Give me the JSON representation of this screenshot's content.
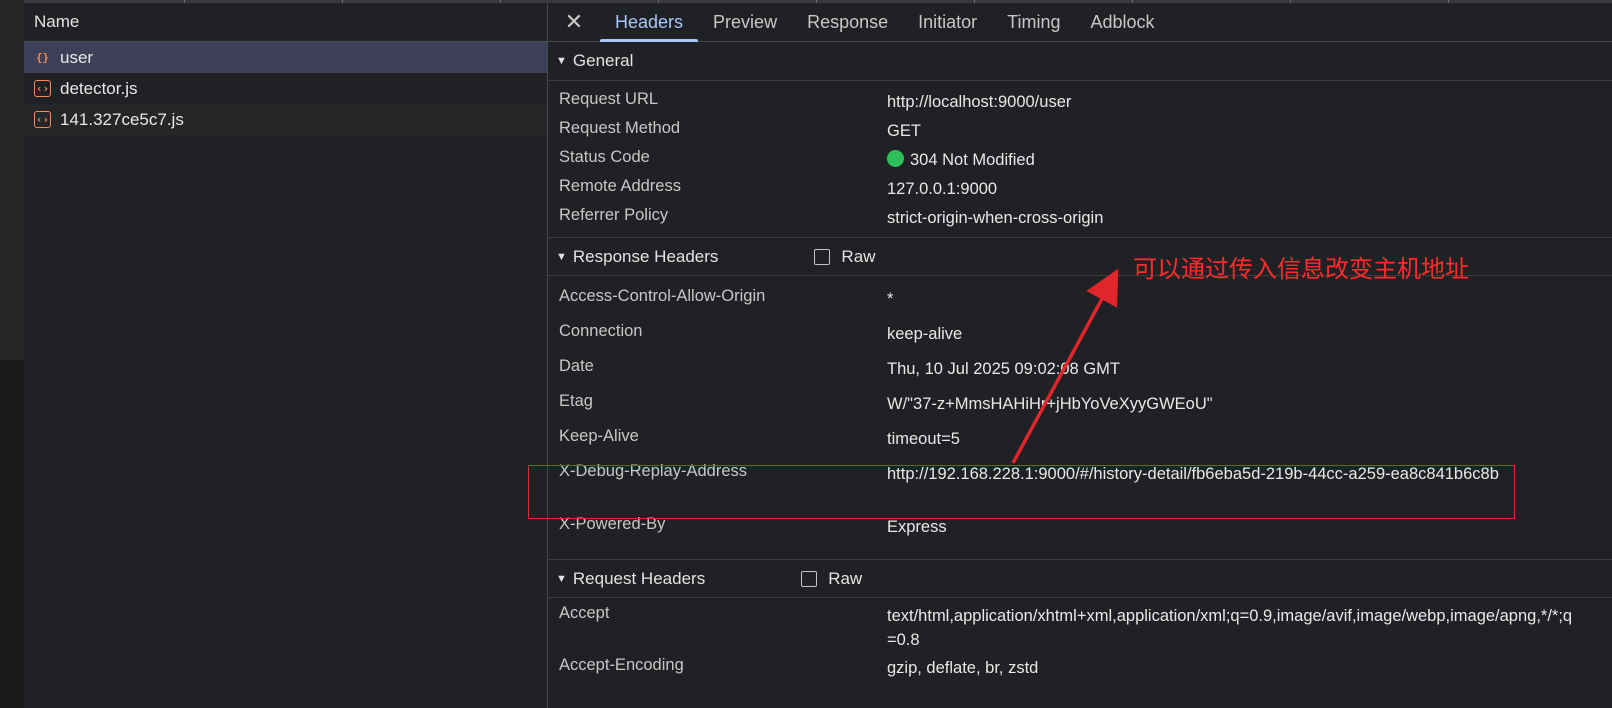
{
  "request_list": {
    "header": "Name",
    "items": [
      {
        "name": "user",
        "type": "json-icon"
      },
      {
        "name": "detector.js",
        "type": "js-icon"
      },
      {
        "name": "141.327ce5c7.js",
        "type": "js-icon"
      }
    ]
  },
  "tabs": [
    "Headers",
    "Preview",
    "Response",
    "Initiator",
    "Timing",
    "Adblock"
  ],
  "active_tab": "Headers",
  "general": {
    "title": "General",
    "rows": [
      {
        "key": "Request URL",
        "value": "http://localhost:9000/user"
      },
      {
        "key": "Request Method",
        "value": "GET"
      },
      {
        "key": "Status Code",
        "value": "304 Not Modified"
      },
      {
        "key": "Remote Address",
        "value": "127.0.0.1:9000"
      },
      {
        "key": "Referrer Policy",
        "value": "strict-origin-when-cross-origin"
      }
    ]
  },
  "response_headers": {
    "title": "Response Headers",
    "raw_label": "Raw",
    "rows": [
      {
        "key": "Access-Control-Allow-Origin",
        "value": "*"
      },
      {
        "key": "Connection",
        "value": "keep-alive"
      },
      {
        "key": "Date",
        "value": "Thu, 10 Jul 2025 09:02:08 GMT"
      },
      {
        "key": "Etag",
        "value": "W/\"37-z+MmsHAHiHr+jHbYoVeXyyGWEoU\""
      },
      {
        "key": "Keep-Alive",
        "value": "timeout=5"
      },
      {
        "key": "X-Debug-Replay-Address",
        "value": "http://192.168.228.1:9000/#/history-detail/fb6eba5d-219b-44cc-a259-ea8c841b6c8b"
      },
      {
        "key": "X-Powered-By",
        "value": "Express"
      }
    ]
  },
  "request_headers": {
    "title": "Request Headers",
    "raw_label": "Raw",
    "rows": [
      {
        "key": "Accept",
        "value": "text/html,application/xhtml+xml,application/xml;q=0.9,image/avif,image/webp,image/apng,*/*;q=0.8"
      },
      {
        "key": "Accept-Encoding",
        "value": "gzip, deflate, br, zstd"
      }
    ]
  },
  "annotation": {
    "text": "可以通过传入信息改变主机地址",
    "color": "#ff2a2a"
  },
  "colors": {
    "accent": "#a8c7fa",
    "status_ok": "#2fbf5a",
    "selected_row": "#3e4059"
  }
}
